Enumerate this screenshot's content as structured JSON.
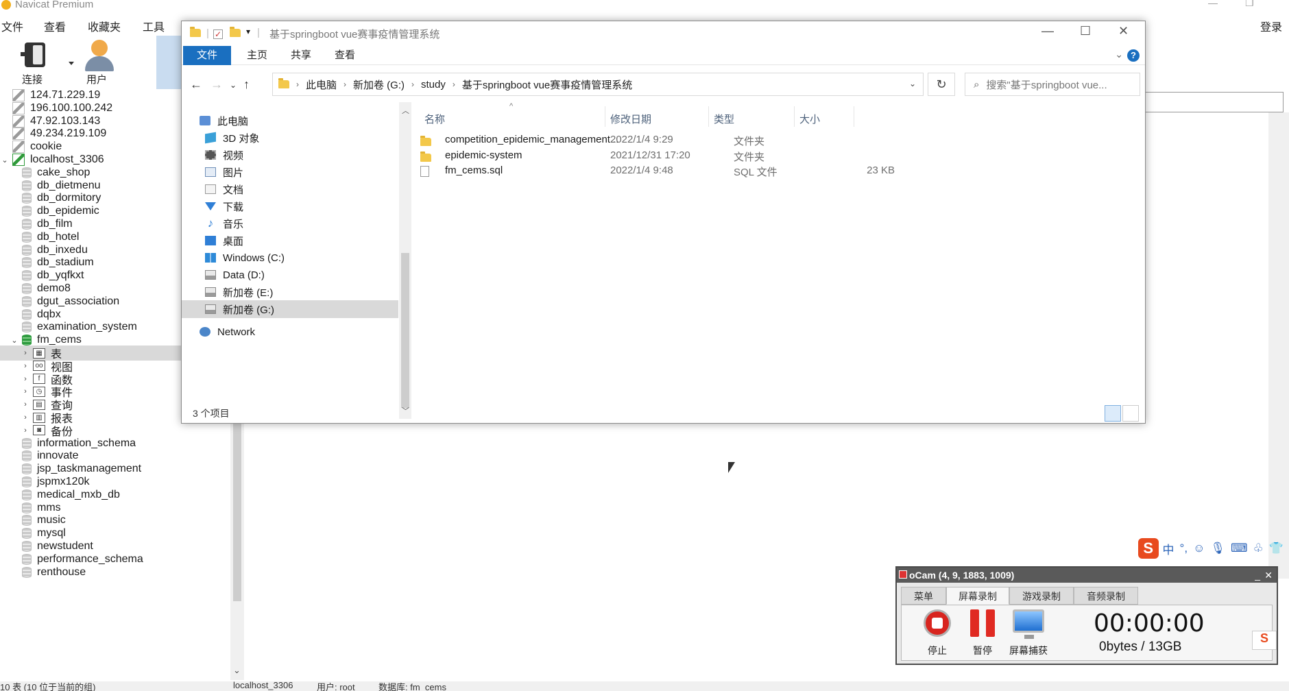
{
  "navicat": {
    "title": "Navicat Premium",
    "menu": [
      "文件",
      "查看",
      "收藏夹",
      "工具"
    ],
    "login": "登录",
    "toolbar": {
      "connect": "连接",
      "user": "用户"
    },
    "tree": [
      {
        "label": "124.71.229.19",
        "kind": "conn"
      },
      {
        "label": "196.100.100.242",
        "kind": "conn"
      },
      {
        "label": "47.92.103.143",
        "kind": "conn"
      },
      {
        "label": "49.234.219.109",
        "kind": "conn"
      },
      {
        "label": "cookie",
        "kind": "conn"
      },
      {
        "label": "localhost_3306",
        "kind": "conn-open"
      },
      {
        "label": "cake_shop",
        "kind": "db"
      },
      {
        "label": "db_dietmenu",
        "kind": "db"
      },
      {
        "label": "db_dormitory",
        "kind": "db"
      },
      {
        "label": "db_epidemic",
        "kind": "db"
      },
      {
        "label": "db_film",
        "kind": "db"
      },
      {
        "label": "db_hotel",
        "kind": "db"
      },
      {
        "label": "db_inxedu",
        "kind": "db"
      },
      {
        "label": "db_stadium",
        "kind": "db"
      },
      {
        "label": "db_yqfkxt",
        "kind": "db"
      },
      {
        "label": "demo8",
        "kind": "db"
      },
      {
        "label": "dgut_association",
        "kind": "db"
      },
      {
        "label": "dqbx",
        "kind": "db"
      },
      {
        "label": "examination_system",
        "kind": "db"
      },
      {
        "label": "fm_cems",
        "kind": "db-open"
      },
      {
        "label": "表",
        "kind": "sub",
        "icon": "table-icon",
        "selected": true
      },
      {
        "label": "视图",
        "kind": "sub",
        "icon": "view-icon"
      },
      {
        "label": "函数",
        "kind": "sub",
        "icon": "function-icon"
      },
      {
        "label": "事件",
        "kind": "sub",
        "icon": "event-icon"
      },
      {
        "label": "查询",
        "kind": "sub",
        "icon": "query-icon"
      },
      {
        "label": "报表",
        "kind": "sub",
        "icon": "report-icon"
      },
      {
        "label": "备份",
        "kind": "sub",
        "icon": "backup-icon"
      },
      {
        "label": "information_schema",
        "kind": "db"
      },
      {
        "label": "innovate",
        "kind": "db"
      },
      {
        "label": "jsp_taskmanagement",
        "kind": "db"
      },
      {
        "label": "jspmx120k",
        "kind": "db"
      },
      {
        "label": "medical_mxb_db",
        "kind": "db"
      },
      {
        "label": "mms",
        "kind": "db"
      },
      {
        "label": "music",
        "kind": "db"
      },
      {
        "label": "mysql",
        "kind": "db"
      },
      {
        "label": "newstudent",
        "kind": "db"
      },
      {
        "label": "performance_schema",
        "kind": "db"
      },
      {
        "label": "renthouse",
        "kind": "db"
      }
    ],
    "status": {
      "left": "10 表 (10 位于当前的组)",
      "conn": "localhost_3306",
      "user": "用户: root",
      "db": "数据库: fm_cems"
    }
  },
  "explorer": {
    "title": "基于springboot vue赛事疫情管理系统",
    "ribbon": {
      "file": "文件",
      "home": "主页",
      "share": "共享",
      "view": "查看"
    },
    "breadcrumb": [
      "此电脑",
      "新加卷 (G:)",
      "study",
      "基于springboot vue赛事疫情管理系统"
    ],
    "search_placeholder": "搜索\"基于springboot vue...",
    "nav": [
      {
        "label": "此电脑",
        "icon": "computer-icon",
        "indent": 1
      },
      {
        "label": "3D 对象",
        "icon": "3d-objects-icon",
        "indent": 2
      },
      {
        "label": "视频",
        "icon": "video-icon",
        "indent": 2
      },
      {
        "label": "图片",
        "icon": "picture-icon",
        "indent": 2
      },
      {
        "label": "文档",
        "icon": "document-icon",
        "indent": 2
      },
      {
        "label": "下载",
        "icon": "download-icon",
        "indent": 2
      },
      {
        "label": "音乐",
        "icon": "music-icon",
        "indent": 2
      },
      {
        "label": "桌面",
        "icon": "desktop-icon",
        "indent": 2
      },
      {
        "label": "Windows (C:)",
        "icon": "windows-drive-icon",
        "indent": 2
      },
      {
        "label": "Data (D:)",
        "icon": "drive-icon",
        "indent": 2
      },
      {
        "label": "新加卷 (E:)",
        "icon": "drive-icon",
        "indent": 2
      },
      {
        "label": "新加卷 (G:)",
        "icon": "drive-icon",
        "indent": 2,
        "selected": true
      },
      {
        "label": "Network",
        "icon": "network-icon",
        "indent": 1
      }
    ],
    "columns": {
      "name": "名称",
      "date": "修改日期",
      "type": "类型",
      "size": "大小"
    },
    "files": [
      {
        "name": "competition_epidemic_management...",
        "date": "2022/1/4 9:29",
        "type": "文件夹",
        "size": "",
        "icon": "folder-icon"
      },
      {
        "name": "epidemic-system",
        "date": "2021/12/31 17:20",
        "type": "文件夹",
        "size": "",
        "icon": "folder-icon"
      },
      {
        "name": "fm_cems.sql",
        "date": "2022/1/4 9:48",
        "type": "SQL 文件",
        "size": "23 KB",
        "icon": "file-icon"
      }
    ],
    "item_count": "3 个项目"
  },
  "ime": {
    "lang": "中",
    "punct": "°,"
  },
  "ocam": {
    "title": "oCam (4, 9, 1883, 1009)",
    "tabs": [
      "菜单",
      "屏幕录制",
      "游戏录制",
      "音频录制"
    ],
    "active_tab": "屏幕录制",
    "buttons": {
      "stop": "停止",
      "pause": "暂停",
      "capture": "屏幕捕获"
    },
    "time": "00:00:00",
    "size": "0bytes / 13GB"
  }
}
